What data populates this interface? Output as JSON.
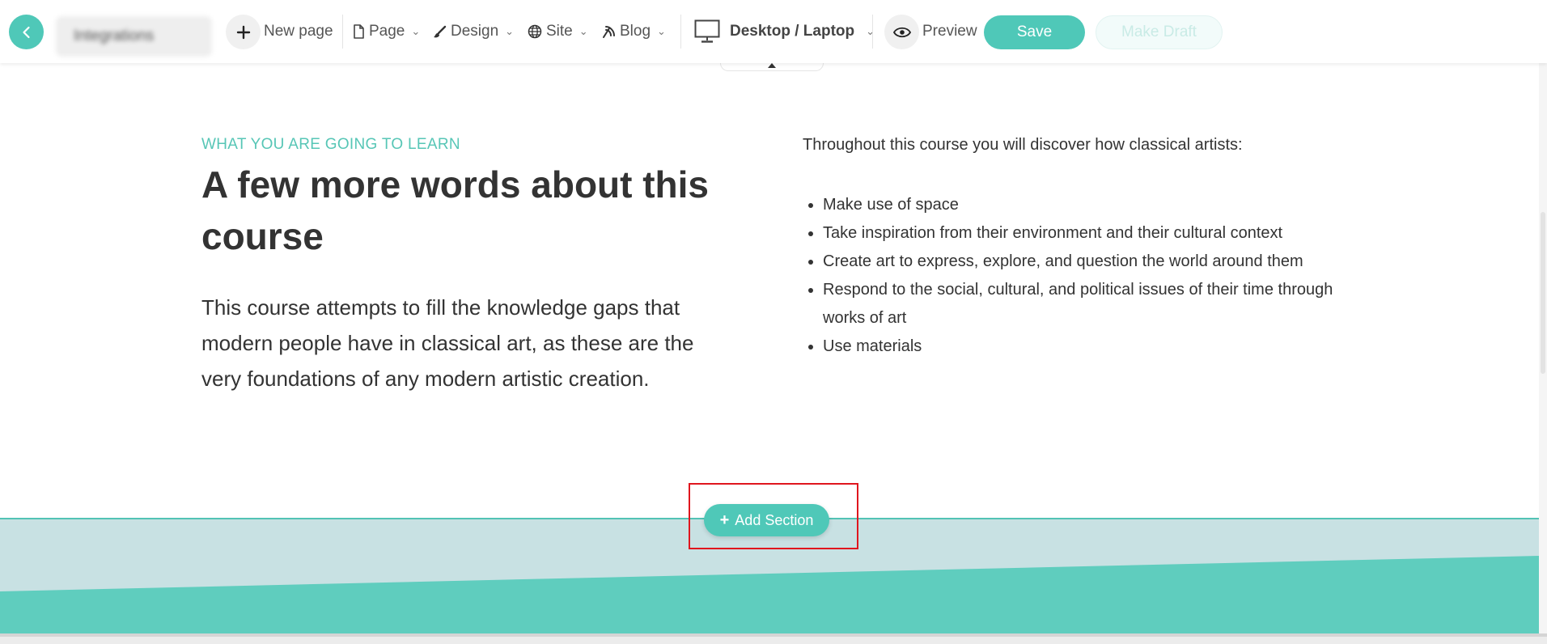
{
  "toolbar": {
    "site_name": "Integrations",
    "new_page_label": "New page",
    "menus": [
      {
        "label": "Page",
        "icon": "page-icon"
      },
      {
        "label": "Design",
        "icon": "brush-icon"
      },
      {
        "label": "Site",
        "icon": "globe-icon"
      },
      {
        "label": "Blog",
        "icon": "rss-icon"
      }
    ],
    "device_label": "Desktop / Laptop",
    "preview_label": "Preview",
    "save_label": "Save",
    "draft_label": "Make Draft"
  },
  "section": {
    "eyebrow": "WHAT YOU ARE GOING TO LEARN",
    "headline": "A few more words about this course",
    "body": "This course attempts to fill the knowledge gaps that modern people have in classical art, as these are the very foundations of any modern artistic creation.",
    "intro": "Throughout this course you will discover how classical artists:",
    "bullets": [
      "Make use of space",
      "Take inspiration from their environment and their cultural context",
      "Create art to express, explore, and question the world around them",
      "Respond to the social, cultural, and political issues of their time through works of art",
      "Use materials"
    ]
  },
  "add_section": {
    "label": "Add Section"
  },
  "colors": {
    "accent": "#4fc8b8",
    "band_light": "#c8e1e3",
    "band_dark": "#5fcdbe",
    "highlight": "#e0161e"
  }
}
